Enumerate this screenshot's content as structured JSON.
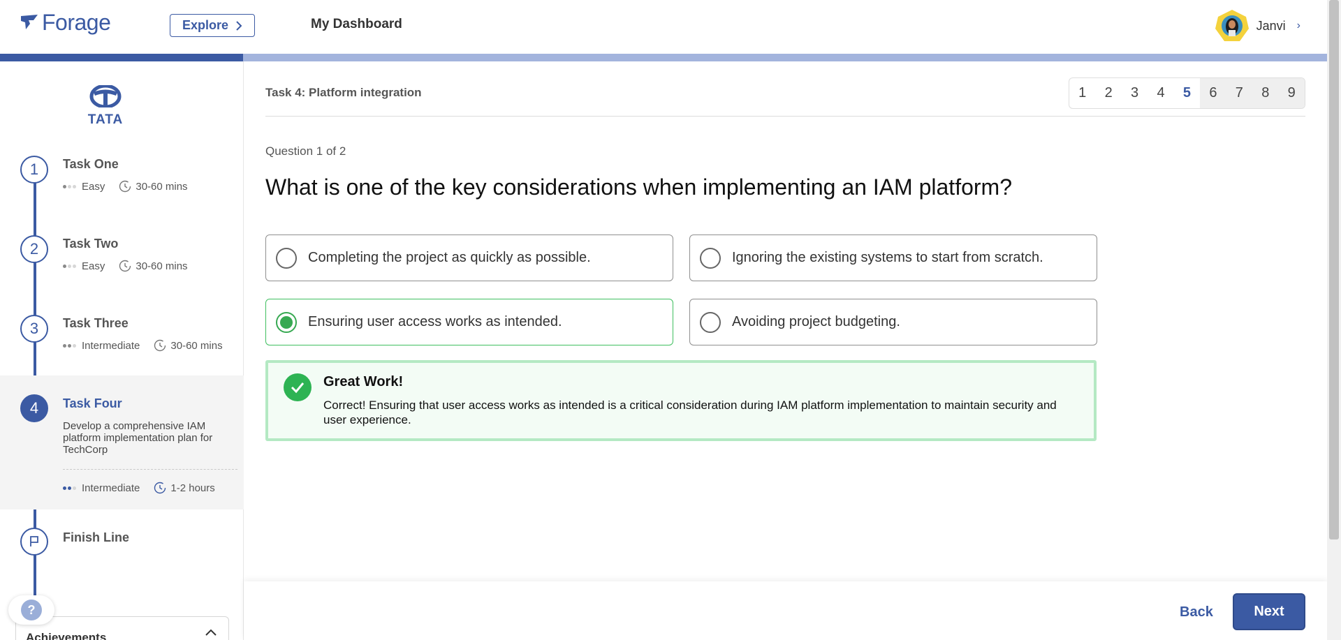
{
  "topbar": {
    "logo_text": "Forage",
    "explore_label": "Explore",
    "dashboard_label": "My Dashboard",
    "user_name": "Janvi"
  },
  "progress": {
    "completed_fraction": 0.183
  },
  "sidebar": {
    "company_logo_text": "TATA",
    "tasks": [
      {
        "number": "1",
        "title": "Task One",
        "difficulty": "Easy",
        "duration": "30-60 mins"
      },
      {
        "number": "2",
        "title": "Task Two",
        "difficulty": "Easy",
        "duration": "30-60 mins"
      },
      {
        "number": "3",
        "title": "Task Three",
        "difficulty": "Intermediate",
        "duration": "30-60 mins"
      },
      {
        "number": "4",
        "title": "Task Four",
        "description": "Develop a comprehensive IAM platform implementation plan for TechCorp",
        "difficulty": "Intermediate",
        "duration": "1-2 hours"
      }
    ],
    "finish_label": "Finish Line",
    "help_label": "?",
    "achievements_label": "Achievements"
  },
  "main": {
    "task_header": "Task 4: Platform integration",
    "pages": [
      "1",
      "2",
      "3",
      "4",
      "5",
      "6",
      "7",
      "8",
      "9"
    ],
    "current_page": "5",
    "question_count": "Question 1 of 2",
    "question": "What is one of the key considerations when implementing an IAM platform?",
    "options": [
      "Completing the project as quickly as possible.",
      "Ignoring the existing systems to start from scratch.",
      "Ensuring user access works as intended.",
      "Avoiding project budgeting."
    ],
    "selected_option": "Ensuring user access works as intended.",
    "feedback_title": "Great Work!",
    "feedback_body": "Correct! Ensuring that user access works as intended is a critical consideration during IAM platform implementation to maintain security and user experience."
  },
  "footer": {
    "back_label": "Back",
    "next_label": "Next"
  },
  "colors": {
    "brand": "#3b5aa3",
    "progress_track": "#a3b4dd",
    "success": "#2db353",
    "success_border": "#b4e9c3"
  }
}
